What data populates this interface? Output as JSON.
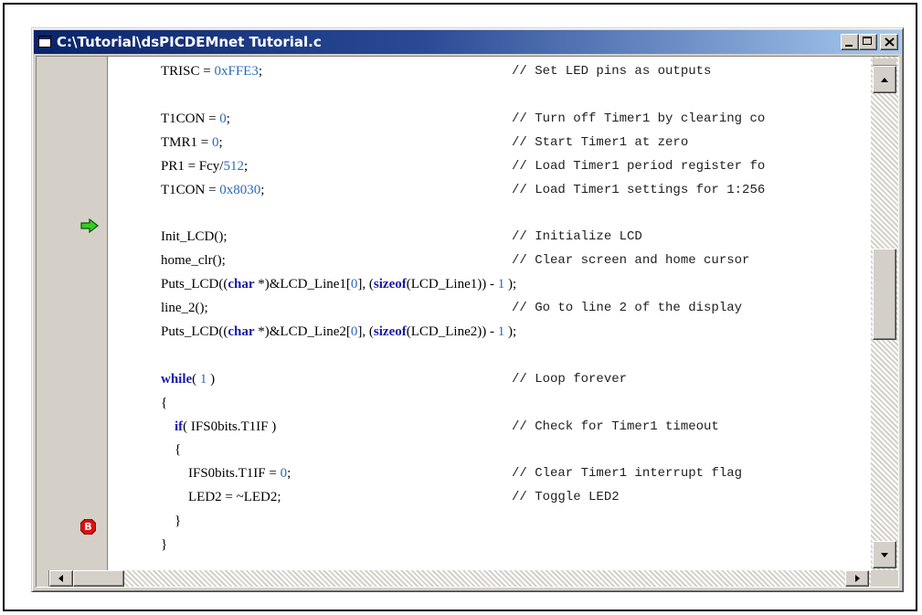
{
  "window": {
    "title": "C:\\Tutorial\\dsPICDEMnet Tutorial.c"
  },
  "markers": {
    "execution_arrow_icon": "green-arrow-icon",
    "breakpoint_label": "B"
  },
  "colors": {
    "keyword": "#1a1aa6",
    "number": "#2a6ab8",
    "title_start": "#0a246a",
    "title_end": "#a6caf0",
    "breakpoint": "#e01010",
    "arrow": "#30d020"
  },
  "code": {
    "lines": [
      {
        "code": "TRISC = 0xFFE3;",
        "comment": "// Set LED pins as outputs"
      },
      {
        "code": "",
        "comment": ""
      },
      {
        "code": "T1CON = 0;",
        "comment": "// Turn off Timer1 by clearing co"
      },
      {
        "code": "TMR1 = 0;",
        "comment": "// Start Timer1 at zero"
      },
      {
        "code": "PR1 = Fcy/512;",
        "comment": "// Load Timer1 period register fo"
      },
      {
        "code": "T1CON = 0x8030;",
        "comment": "// Load Timer1 settings for 1:256"
      },
      {
        "code": "",
        "comment": ""
      },
      {
        "code": "Init_LCD();",
        "comment": "// Initialize LCD"
      },
      {
        "code": "home_clr();",
        "comment": "// Clear screen and home cursor"
      },
      {
        "code": "Puts_LCD((char *)&LCD_Line1[0], (sizeof(LCD_Line1)) - 1 );",
        "comment": ""
      },
      {
        "code": "line_2();",
        "comment": "// Go to line 2 of the display"
      },
      {
        "code": "Puts_LCD((char *)&LCD_Line2[0], (sizeof(LCD_Line2)) - 1 );",
        "comment": ""
      },
      {
        "code": "",
        "comment": ""
      },
      {
        "code": "while( 1 )",
        "comment": "// Loop forever"
      },
      {
        "code": "{",
        "comment": ""
      },
      {
        "code": "    if( IFS0bits.T1IF )",
        "comment": "// Check for Timer1 timeout"
      },
      {
        "code": "    {",
        "comment": ""
      },
      {
        "code": "        IFS0bits.T1IF = 0;",
        "comment": "// Clear Timer1 interrupt flag"
      },
      {
        "code": "        LED2 = ~LED2;",
        "comment": "// Toggle LED2"
      },
      {
        "code": "    }",
        "comment": ""
      },
      {
        "code": "}",
        "comment": ""
      }
    ]
  }
}
